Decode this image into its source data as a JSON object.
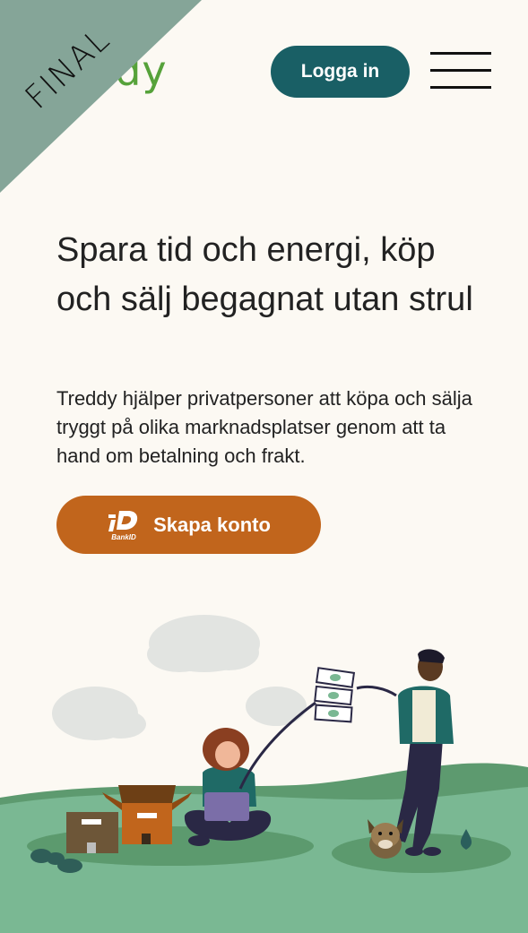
{
  "header": {
    "logo_text": "Treddy",
    "logo_visible_text": "ddy",
    "ribbon_label": "FINAL",
    "login_label": "Logga in",
    "menu_icon": "hamburger-menu-icon"
  },
  "hero": {
    "title": "Spara tid och energi, köp och sälj begagnat utan strul",
    "description": "Treddy hjälper privatpersoner att köpa och sälja tryggt på olika marknadsplatser genom att ta hand om betalning och frakt.",
    "cta_label": "Skapa konto",
    "cta_icon": "bankid-icon",
    "bankid_text": "BankID"
  },
  "colors": {
    "brand_green": "#56a23a",
    "primary_teal": "#195f65",
    "cta_orange": "#c1651c",
    "ribbon": "#85a598",
    "background": "#fcf9f3"
  }
}
